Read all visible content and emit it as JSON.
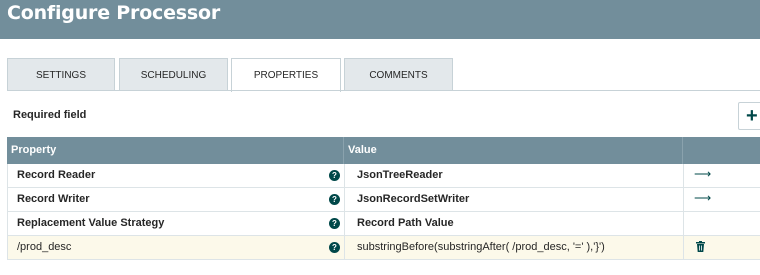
{
  "dialog": {
    "title": "Configure Processor"
  },
  "tabs": [
    {
      "label": "SETTINGS"
    },
    {
      "label": "SCHEDULING"
    },
    {
      "label": "PROPERTIES"
    },
    {
      "label": "COMMENTS"
    }
  ],
  "active_tab": "PROPERTIES",
  "required_label": "Required field",
  "add_icon": "+",
  "table": {
    "headers": {
      "property": "Property",
      "value": "Value"
    },
    "rows": [
      {
        "property": "Record Reader",
        "value": "JsonTreeReader",
        "action": "arrow-right-icon"
      },
      {
        "property": "Record Writer",
        "value": "JsonRecordSetWriter",
        "action": "arrow-right-icon"
      },
      {
        "property": "Replacement Value Strategy",
        "value": "Record Path Value",
        "action": ""
      },
      {
        "property": "/prod_desc",
        "value": "substringBefore(substringAfter( /prod_desc, '=' ),'}')",
        "action": "trash-icon"
      }
    ]
  },
  "colors": {
    "header_bg": "#728e9b",
    "accent": "#004849",
    "highlight_row": "#fcf9ea"
  }
}
